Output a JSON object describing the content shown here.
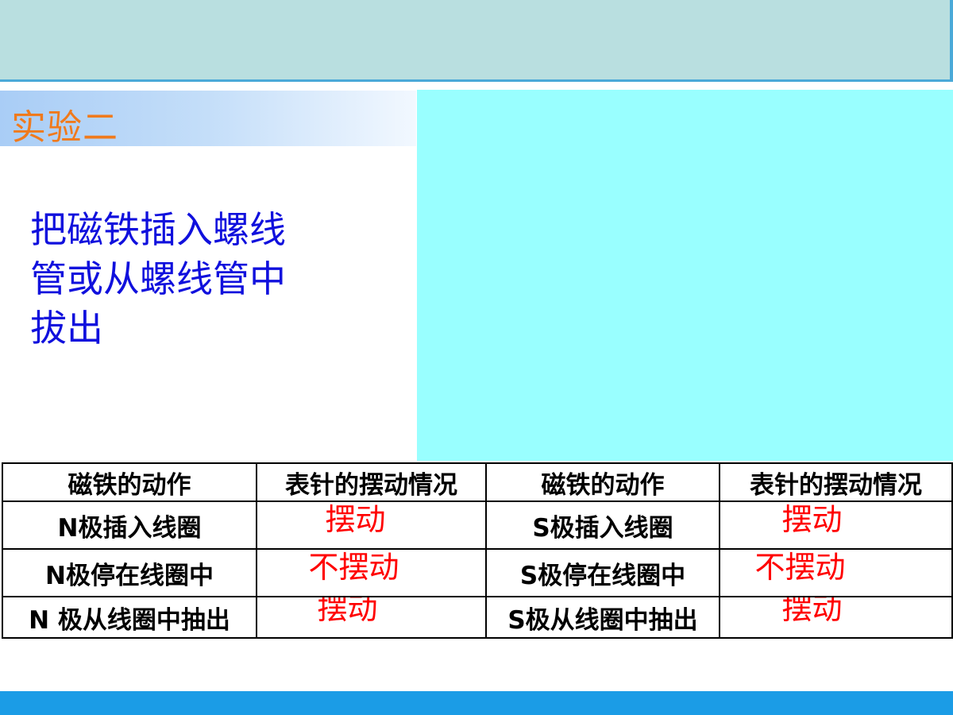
{
  "title": "实验二",
  "description": [
    "把磁铁插入螺线",
    "管或从螺线管中",
    "拔出"
  ],
  "table": {
    "headers": [
      "磁铁的动作",
      "表针的摆动情况",
      "磁铁的动作",
      "表针的摆动情况"
    ],
    "rows": [
      [
        "N极插入线圈",
        "摆动",
        "S极插入线圈",
        "摆动"
      ],
      [
        "N极停在线圈中",
        "不摆动",
        "S极停在线圈中",
        "不摆动"
      ],
      [
        "N 极从线圈中抽出",
        "摆动",
        "S极从线圈中抽出",
        "摆动"
      ]
    ]
  }
}
